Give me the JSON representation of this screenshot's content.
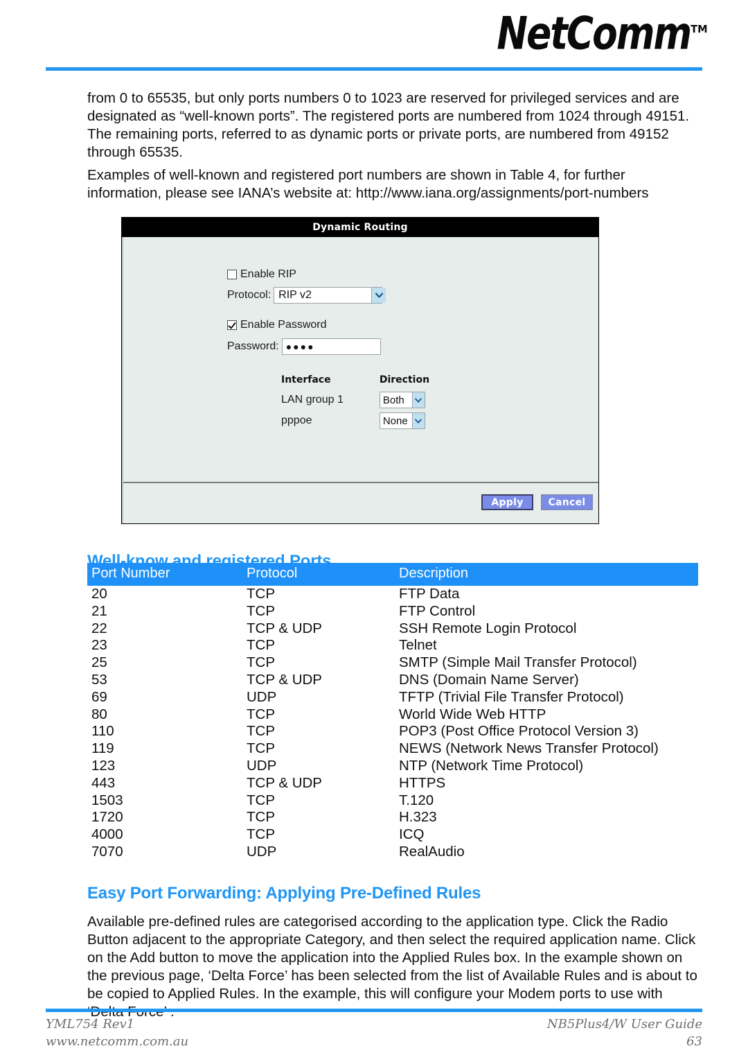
{
  "header": {
    "brand": "NetComm",
    "trademark": "TM"
  },
  "intro": {
    "para1": "from 0 to 65535, but only ports numbers 0 to 1023 are reserved for privileged services and are designated as “well-known ports”. The registered ports are numbered from 1024 through 49151. The remaining ports, referred to as dynamic ports or private ports, are numbered from 49152 through 65535.",
    "para2": "Examples of well-known and registered port numbers are shown in Table 4, for further information, please see IANA’s website at: http://www.iana.org/assignments/port-numbers"
  },
  "router_panel": {
    "title": "Dynamic Routing",
    "enable_rip": {
      "label": "Enable RIP",
      "checked": false
    },
    "protocol": {
      "label": "Protocol:",
      "value": "RIP v2"
    },
    "enable_password": {
      "label": "Enable Password",
      "checked": true
    },
    "password": {
      "label": "Password:",
      "value": "●●●●"
    },
    "interface_table": {
      "headers": [
        "Interface",
        "Direction"
      ],
      "rows": [
        {
          "interface": "LAN group 1",
          "direction": "Both"
        },
        {
          "interface": "pppoe",
          "direction": "None"
        }
      ]
    },
    "buttons": {
      "apply": "Apply",
      "cancel": "Cancel"
    }
  },
  "ports_section": {
    "heading": "Well-know and registered Ports",
    "table": {
      "headers": [
        "Port Number",
        "Protocol",
        "Description"
      ],
      "rows": [
        [
          "20",
          "TCP",
          "FTP Data"
        ],
        [
          "21",
          "TCP",
          "FTP Control"
        ],
        [
          "22",
          "TCP & UDP",
          "SSH Remote Login Protocol"
        ],
        [
          "23",
          "TCP",
          "Telnet"
        ],
        [
          "25",
          "TCP",
          "SMTP (Simple Mail Transfer Protocol)"
        ],
        [
          "53",
          "TCP & UDP",
          "DNS (Domain Name Server)"
        ],
        [
          "69",
          "UDP",
          "TFTP (Trivial File Transfer Protocol)"
        ],
        [
          "80",
          "TCP",
          "World Wide Web HTTP"
        ],
        [
          "110",
          "TCP",
          "POP3 (Post Office Protocol Version 3)"
        ],
        [
          "119",
          "TCP",
          "NEWS (Network News Transfer Protocol)"
        ],
        [
          "123",
          "UDP",
          "NTP (Network Time Protocol)"
        ],
        [
          "443",
          "TCP & UDP",
          "HTTPS"
        ],
        [
          "1503",
          "TCP",
          "T.120"
        ],
        [
          "1720",
          "TCP",
          "H.323"
        ],
        [
          "4000",
          "TCP",
          "ICQ"
        ],
        [
          "7070",
          "UDP",
          "RealAudio"
        ]
      ]
    }
  },
  "easy_port_forwarding": {
    "heading": "Easy Port Forwarding: Applying Pre-Defined Rules",
    "para": "Available pre-defined rules are categorised according to the application type.  Click the Radio Button adjacent to the appropriate Category, and then select the required application name. Click on the Add button to move the application into the Applied Rules box. In the example shown on the previous page, ‘Delta Force’ has been selected from the list of Available Rules and is about to be copied to Applied Rules.  In the example, this will configure your Modem ports to use with ‘Delta Force’ ."
  },
  "footer": {
    "doc_ref": "YML754 Rev1",
    "website": "www.netcomm.com.au",
    "product": "NB5Plus4/W User Guide",
    "page_number": "63"
  },
  "colors": {
    "accent_blue": "#2196f3",
    "table_header_blue": "#1e90f7",
    "panel_bg": "#e7edeb",
    "button_blue": "#7b8ce8"
  }
}
